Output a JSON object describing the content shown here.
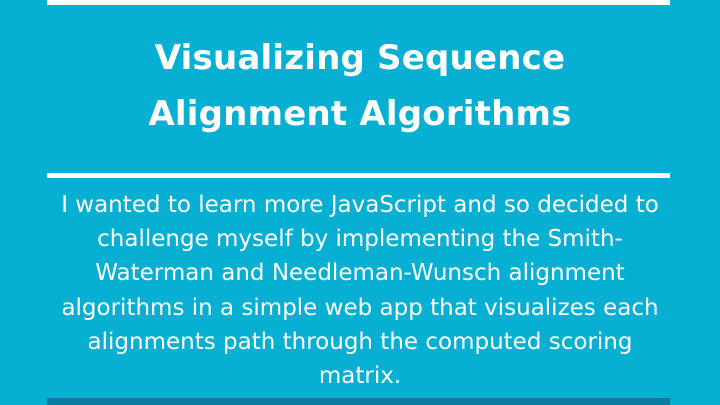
{
  "slide": {
    "title": "Visualizing Sequence Alignment Algorithms",
    "body": "I wanted to learn more JavaScript and so decided to challenge myself by implementing the Smith-Waterman and Needleman-Wunsch alignment algorithms in a simple web app that visualizes each alignments path through the computed scoring matrix.",
    "colors": {
      "background": "#07afd2",
      "text": "#ffffff",
      "rule": "#ffffff",
      "bottom_band": "#0a7ca0"
    }
  }
}
